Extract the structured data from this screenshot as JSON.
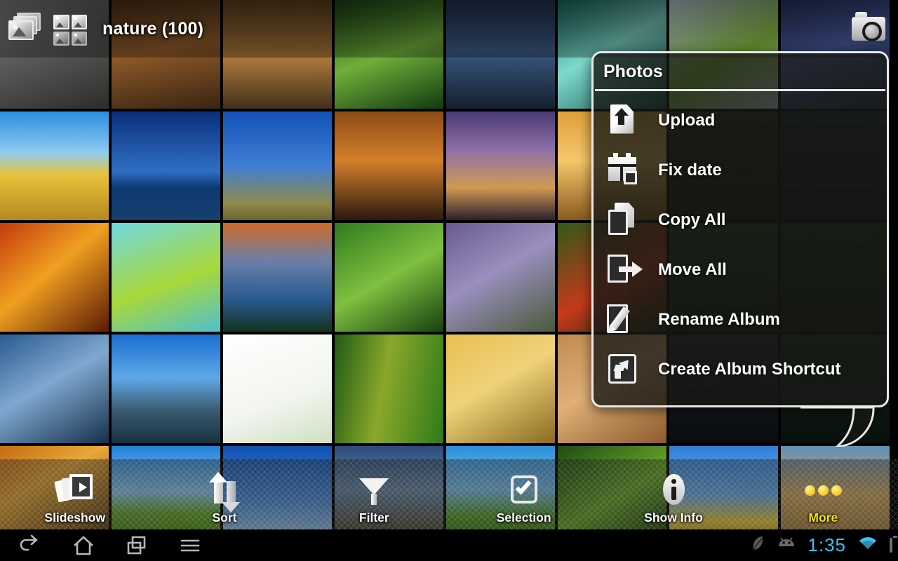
{
  "actionbar": {
    "app_icon": "gallery-stack-icon",
    "view_icon": "grid-view-icon",
    "title": "nature (100)",
    "camera_icon": "camera-icon"
  },
  "popup": {
    "title": "Photos",
    "items": [
      {
        "label": "Upload",
        "icon": "upload-icon"
      },
      {
        "label": "Fix date",
        "icon": "calendar-icon"
      },
      {
        "label": "Copy All",
        "icon": "copy-icon"
      },
      {
        "label": "Move All",
        "icon": "move-icon"
      },
      {
        "label": "Rename Album",
        "icon": "rename-icon"
      },
      {
        "label": "Create Album Shortcut",
        "icon": "shortcut-icon"
      }
    ]
  },
  "toolbar": {
    "items": [
      {
        "label": "Slideshow",
        "icon": "slideshow-icon",
        "active": false
      },
      {
        "label": "Sort",
        "icon": "sort-arrows-icon",
        "active": false
      },
      {
        "label": "Filter",
        "icon": "funnel-icon",
        "active": false
      },
      {
        "label": "Selection",
        "icon": "checkbox-icon",
        "active": false
      },
      {
        "label": "Show Info",
        "icon": "info-icon",
        "active": false
      },
      {
        "label": "More",
        "icon": "three-dots-icon",
        "active": true
      }
    ],
    "active_color": "#ffe400"
  },
  "systembar": {
    "nav": [
      {
        "name": "back-icon"
      },
      {
        "name": "home-icon"
      },
      {
        "name": "recent-apps-icon"
      },
      {
        "name": "menu-icon"
      }
    ],
    "status": {
      "notification_icons": [
        "leaf-notification-icon",
        "android-robot-icon"
      ],
      "clock": "1:35",
      "wifi_icon": "wifi-icon",
      "battery_icon": "battery-icon",
      "clock_color": "#3ec0ee",
      "battery_color": "#f07d1a"
    }
  },
  "grid": {
    "columns": 8,
    "rows": 5,
    "cell": 155,
    "gap": 4,
    "photos": [
      {
        "r": 0,
        "c": 0,
        "desc": "dark-pebbles",
        "css": "linear-gradient(160deg,#9a9a96 0%,#5e5e5c 40%,#2c2c2b 100%)"
      },
      {
        "r": 0,
        "c": 1,
        "desc": "rusty-bark-texture",
        "css": "linear-gradient(170deg,#5a3a1e 0%,#8f5a2a 45%,#3a2411 100%)"
      },
      {
        "r": 0,
        "c": 2,
        "desc": "canyon-rock",
        "css": "linear-gradient(180deg,#6c4a22 0%,#a8763a 55%,#43301a 100%)"
      },
      {
        "r": 0,
        "c": 3,
        "desc": "forest-canopy-sky",
        "css": "linear-gradient(160deg,#1d4e16 0%,#6fae3a 50%,#123a10 100%)"
      },
      {
        "r": 0,
        "c": 4,
        "desc": "sea-cliffs-sunset",
        "css": "linear-gradient(180deg,#233a5c 0%,#3b5a82 45%,#14202f 100%)"
      },
      {
        "r": 0,
        "c": 5,
        "desc": "turquoise-stream",
        "css": "linear-gradient(150deg,#1d7d72 0%,#7fd9cc 45%,#15544e 100%)"
      },
      {
        "r": 0,
        "c": 6,
        "desc": "green-leaves-sky",
        "css": "linear-gradient(150deg,#cfe6f5 0%,#8cc63f 55%,#cfe6f5 100%)"
      },
      {
        "r": 0,
        "c": 7,
        "desc": "blue-lupine-flowers",
        "css": "linear-gradient(160deg,#2b3a6b 0%,#4d5fa8 45%,#1b2a3c 100%)"
      },
      {
        "r": 1,
        "c": 0,
        "desc": "golden-field-blue-sky",
        "css": "linear-gradient(to bottom,#2a8ede 0%,#8fcbf0 38%,#e8c33c 58%,#b5881f 100%)"
      },
      {
        "r": 1,
        "c": 1,
        "desc": "deep-blue-ocean-horizon",
        "css": "linear-gradient(to bottom,#0a2f7a 0%,#2f6fc4 55%,#0e3a73 70%,#163f6d 100%)"
      },
      {
        "r": 1,
        "c": 2,
        "desc": "reeds-against-sky",
        "css": "linear-gradient(to bottom,#1450b8 0%,#3f7fd4 50%,#8f8a4a 85%,#6a6330 100%)"
      },
      {
        "r": 1,
        "c": 3,
        "desc": "palm-trees-sunset",
        "css": "linear-gradient(to bottom,#8c4a14 0%,#d4802c 45%,#2a1a0c 100%)"
      },
      {
        "r": 1,
        "c": 4,
        "desc": "purple-sunset-beach",
        "css": "linear-gradient(to bottom,#4a3a72 0%,#8f6fa8 35%,#d09a52 70%,#2a1f2e 100%)"
      },
      {
        "r": 1,
        "c": 5,
        "desc": "orange-sunset-water",
        "css": "linear-gradient(to bottom,#e0a03a 0%,#f5c76a 45%,#8a5a1e 100%)"
      },
      {
        "r": 1,
        "c": 6,
        "desc": "dark-scene",
        "css": "linear-gradient(to bottom,#1f2a1a,#0d1209)"
      },
      {
        "r": 1,
        "c": 7,
        "desc": "dark-scene-2",
        "css": "linear-gradient(to bottom,#1a2030,#0a0d14)"
      },
      {
        "r": 2,
        "c": 0,
        "desc": "autumn-forest-sunlight",
        "css": "linear-gradient(140deg,#c43a0c 0%,#f0a020 45%,#5a1a06 100%)"
      },
      {
        "r": 2,
        "c": 1,
        "desc": "green-leaf-on-turquoise",
        "css": "linear-gradient(160deg,#6fd8e0 0%,#a8d83a 55%,#4fc0cf 100%)"
      },
      {
        "r": 2,
        "c": 2,
        "desc": "mountain-lake-dusk",
        "css": "linear-gradient(to bottom,#d06a2a 0%,#6a7fa8 35%,#2a5a8f 70%,#14321f 100%)"
      },
      {
        "r": 2,
        "c": 3,
        "desc": "green-leaves-closeup",
        "css": "linear-gradient(150deg,#2f7a1f 0%,#7fc040 50%,#16400f 100%)"
      },
      {
        "r": 2,
        "c": 4,
        "desc": "lavender-field",
        "css": "linear-gradient(150deg,#6a5a8f 0%,#9a8fbf 45%,#4a5a3a 100%)"
      },
      {
        "r": 2,
        "c": 5,
        "desc": "red-leaf-dark",
        "css": "linear-gradient(150deg,#2f5a18 0%,#c43a1a 55%,#1a2a0e 100%)"
      },
      {
        "r": 2,
        "c": 6,
        "desc": "dark-green-foliage",
        "css": "linear-gradient(to bottom,#1c3a18,#0b1608)"
      },
      {
        "r": 2,
        "c": 7,
        "desc": "dark-foliage-2",
        "css": "linear-gradient(to bottom,#16331a,#081008)"
      },
      {
        "r": 3,
        "c": 0,
        "desc": "frosty-blue-berries",
        "css": "linear-gradient(150deg,#2a5a8f 0%,#7fa8d0 45%,#17304a 100%)"
      },
      {
        "r": 3,
        "c": 1,
        "desc": "rocky-coast-blue-sky",
        "css": "linear-gradient(to bottom,#1a6fd0 0%,#5fa8e8 40%,#3a5a6f 70%,#17303f 100%)"
      },
      {
        "r": 3,
        "c": 2,
        "desc": "white-wildflower-highkey",
        "css": "linear-gradient(160deg,#ffffff 0%,#f2f5ef 60%,#cfe0c0 100%)"
      },
      {
        "r": 3,
        "c": 3,
        "desc": "green-hanging-grass",
        "css": "linear-gradient(100deg,#1f5a14 0%,#8aa82a 45%,#2f7a1a 100%)"
      },
      {
        "r": 3,
        "c": 4,
        "desc": "golden-wheat-ears",
        "css": "linear-gradient(150deg,#e8c050 0%,#f0d27a 45%,#8a6a20 100%)"
      },
      {
        "r": 3,
        "c": 5,
        "desc": "desert-sand-dunes",
        "css": "linear-gradient(150deg,#c08a50 0%,#e0b078 45%,#8a5a2a 100%)"
      },
      {
        "r": 3,
        "c": 6,
        "desc": "dark-scene-3",
        "css": "linear-gradient(to bottom,#20242a,#0a0c0f)"
      },
      {
        "r": 3,
        "c": 7,
        "desc": "dark-scene-4",
        "css": "linear-gradient(to bottom,#1a2a20,#080f0b)"
      },
      {
        "r": 4,
        "c": 0,
        "desc": "autumn-path-forest",
        "css": "linear-gradient(150deg,#c46a14 0%,#e8a83a 35%,#3a2a10 100%)"
      },
      {
        "r": 4,
        "c": 1,
        "desc": "green-meadow-blue-sky",
        "css": "linear-gradient(to bottom,#1f7fd8 0%,#8fcbf0 42%,#6aa82a 62%,#2f6a14 100%)"
      },
      {
        "r": 4,
        "c": 2,
        "desc": "clouds-blue-sky",
        "css": "linear-gradient(to bottom,#0f4fb0 0%,#4f8fd8 50%,#a8c8e8 85%,#5f8fb0 100%)"
      },
      {
        "r": 4,
        "c": 3,
        "desc": "mountain-lake-road",
        "css": "linear-gradient(to bottom,#2a4a7a 0%,#6a8aa8 40%,#5a5a50 70%,#2a2a24 100%)"
      },
      {
        "r": 4,
        "c": 4,
        "desc": "green-grass-blue-sky",
        "css": "linear-gradient(to bottom,#2a8fd8 0%,#7fc0e8 40%,#5a9a2a 65%,#2a5a14 100%)"
      },
      {
        "r": 4,
        "c": 5,
        "desc": "green-leaves-macro",
        "css": "linear-gradient(150deg,#1f4a14 0%,#6aa82a 50%,#0e2a0a 100%)"
      },
      {
        "r": 4,
        "c": 6,
        "desc": "yellow-daffodil-blue-sky",
        "css": "linear-gradient(to bottom,#2f7fd8 0%,#6fb0e8 45%,#e8c83a 70%,#3a6a1a 100%)"
      },
      {
        "r": 4,
        "c": 7,
        "desc": "wheat-field-horizon",
        "css": "linear-gradient(to bottom,#5f8fb8 0%,#cfa860 45%,#8a6a2a 100%)"
      }
    ]
  }
}
